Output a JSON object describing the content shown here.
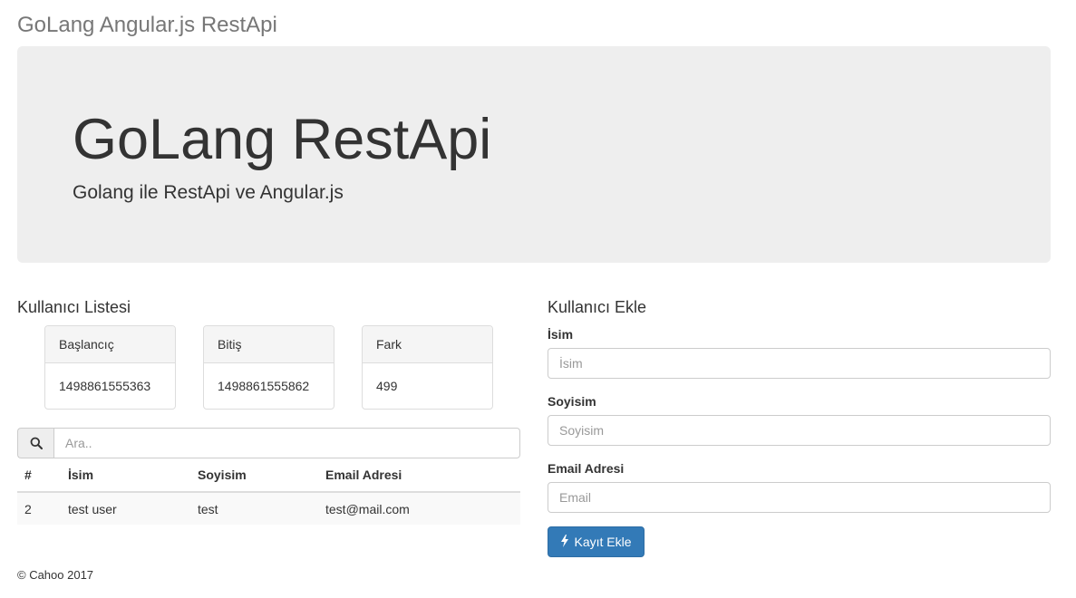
{
  "navbar": {
    "brand": "GoLang Angular.js RestApi"
  },
  "jumbotron": {
    "title": "GoLang RestApi",
    "subtitle": "Golang ile RestApi ve Angular.js"
  },
  "user_list": {
    "title": "Kullanıcı Listesi",
    "stats": [
      {
        "label": "Başlancıç",
        "value": "1498861555363"
      },
      {
        "label": "Bitiş",
        "value": "1498861555862"
      },
      {
        "label": "Fark",
        "value": "499"
      }
    ],
    "search": {
      "placeholder": "Ara..",
      "icon": "search-icon"
    },
    "table": {
      "headers": [
        "#",
        "İsim",
        "Soyisim",
        "Email Adresi"
      ],
      "rows": [
        [
          "2",
          "test user",
          "test",
          "test@mail.com"
        ]
      ]
    }
  },
  "add_user": {
    "title": "Kullanıcı Ekle",
    "fields": [
      {
        "label": "İsim",
        "placeholder": "İsim",
        "value": ""
      },
      {
        "label": "Soyisim",
        "placeholder": "Soyisim",
        "value": ""
      },
      {
        "label": "Email Adresi",
        "placeholder": "Email",
        "value": ""
      }
    ],
    "submit": {
      "label": "Kayıt Ekle",
      "icon": "flash-icon"
    }
  },
  "footer": {
    "text": "© Cahoo 2017"
  },
  "colors": {
    "primary": "#337ab7",
    "jumbotron_bg": "#eeeeee",
    "brand_text": "#777777"
  }
}
